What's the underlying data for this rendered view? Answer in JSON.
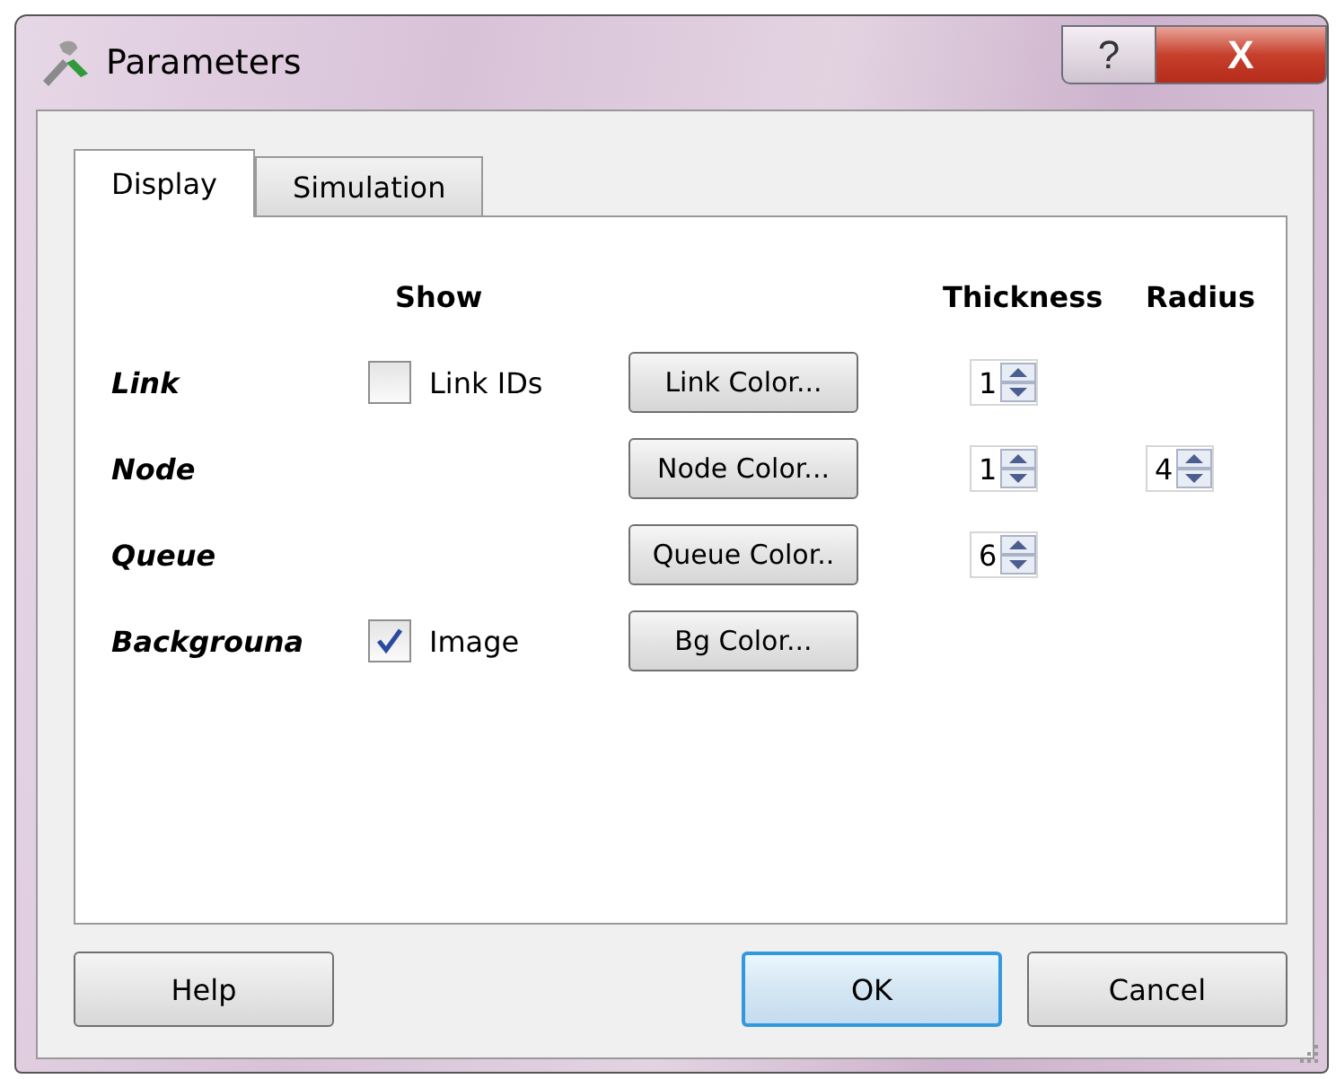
{
  "window": {
    "title": "Parameters",
    "help_button": "?",
    "close_button": "X"
  },
  "tabs": [
    {
      "label": "Display",
      "selected": true
    },
    {
      "label": "Simulation",
      "selected": false
    }
  ],
  "headers": {
    "show": "Show",
    "thickness": "Thickness",
    "radius": "Radius"
  },
  "rows": [
    {
      "label": "Link",
      "show": {
        "label": "Link IDs",
        "checked": false
      },
      "button": "Link Color...",
      "thickness": "1"
    },
    {
      "label": "Node",
      "button": "Node Color...",
      "thickness": "1",
      "radius": "4"
    },
    {
      "label": "Queue",
      "button": "Queue Color..",
      "thickness": "6"
    },
    {
      "label": "Backgrouna",
      "show": {
        "label": "Image",
        "checked": true
      },
      "button": "Bg Color..."
    }
  ],
  "buttons": [
    {
      "label": "Help",
      "default": false
    },
    {
      "label": "OK",
      "default": true
    },
    {
      "label": "Cancel",
      "default": false
    }
  ]
}
